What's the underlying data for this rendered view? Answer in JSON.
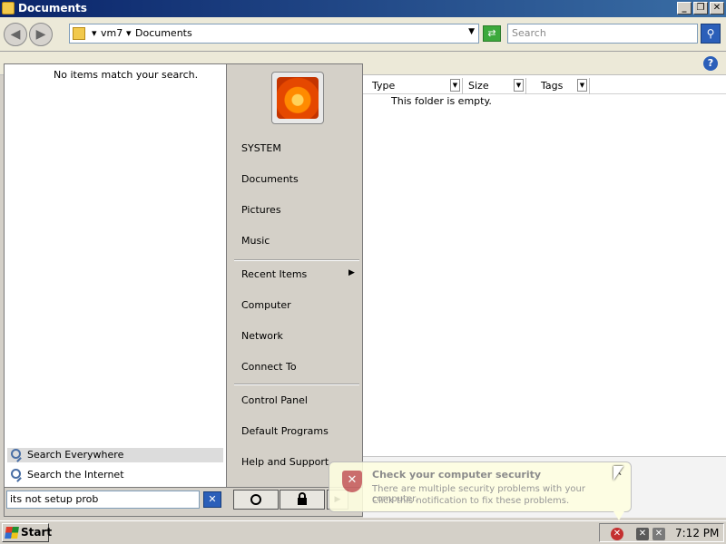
{
  "window": {
    "title": "Documents"
  },
  "address": {
    "crumbs": [
      "vm7",
      "Documents"
    ],
    "search_placeholder": "Search"
  },
  "columns": [
    "Type",
    "Size",
    "Tags"
  ],
  "content": {
    "empty_message": "This folder is empty."
  },
  "start_menu": {
    "no_items": "No items match your search.",
    "search_everywhere": "Search Everywhere",
    "search_internet": "Search the Internet",
    "search_query": "its not setup prob",
    "right_items": {
      "system": "SYSTEM",
      "documents": "Documents",
      "pictures": "Pictures",
      "music": "Music",
      "recent": "Recent Items",
      "computer": "Computer",
      "network": "Network",
      "connect": "Connect To",
      "control_panel": "Control Panel",
      "default_programs": "Default Programs",
      "help": "Help and Support"
    }
  },
  "balloon": {
    "title": "Check your computer security",
    "line1": "There are multiple security problems with your computer.",
    "line2": "Click this notification to fix these problems."
  },
  "taskbar": {
    "start_label": "Start",
    "clock": "7:12 PM"
  },
  "colors": {
    "titlebar": "#0a246a",
    "balloon_bg": "#ffffe1",
    "security_red": "#c43030"
  }
}
